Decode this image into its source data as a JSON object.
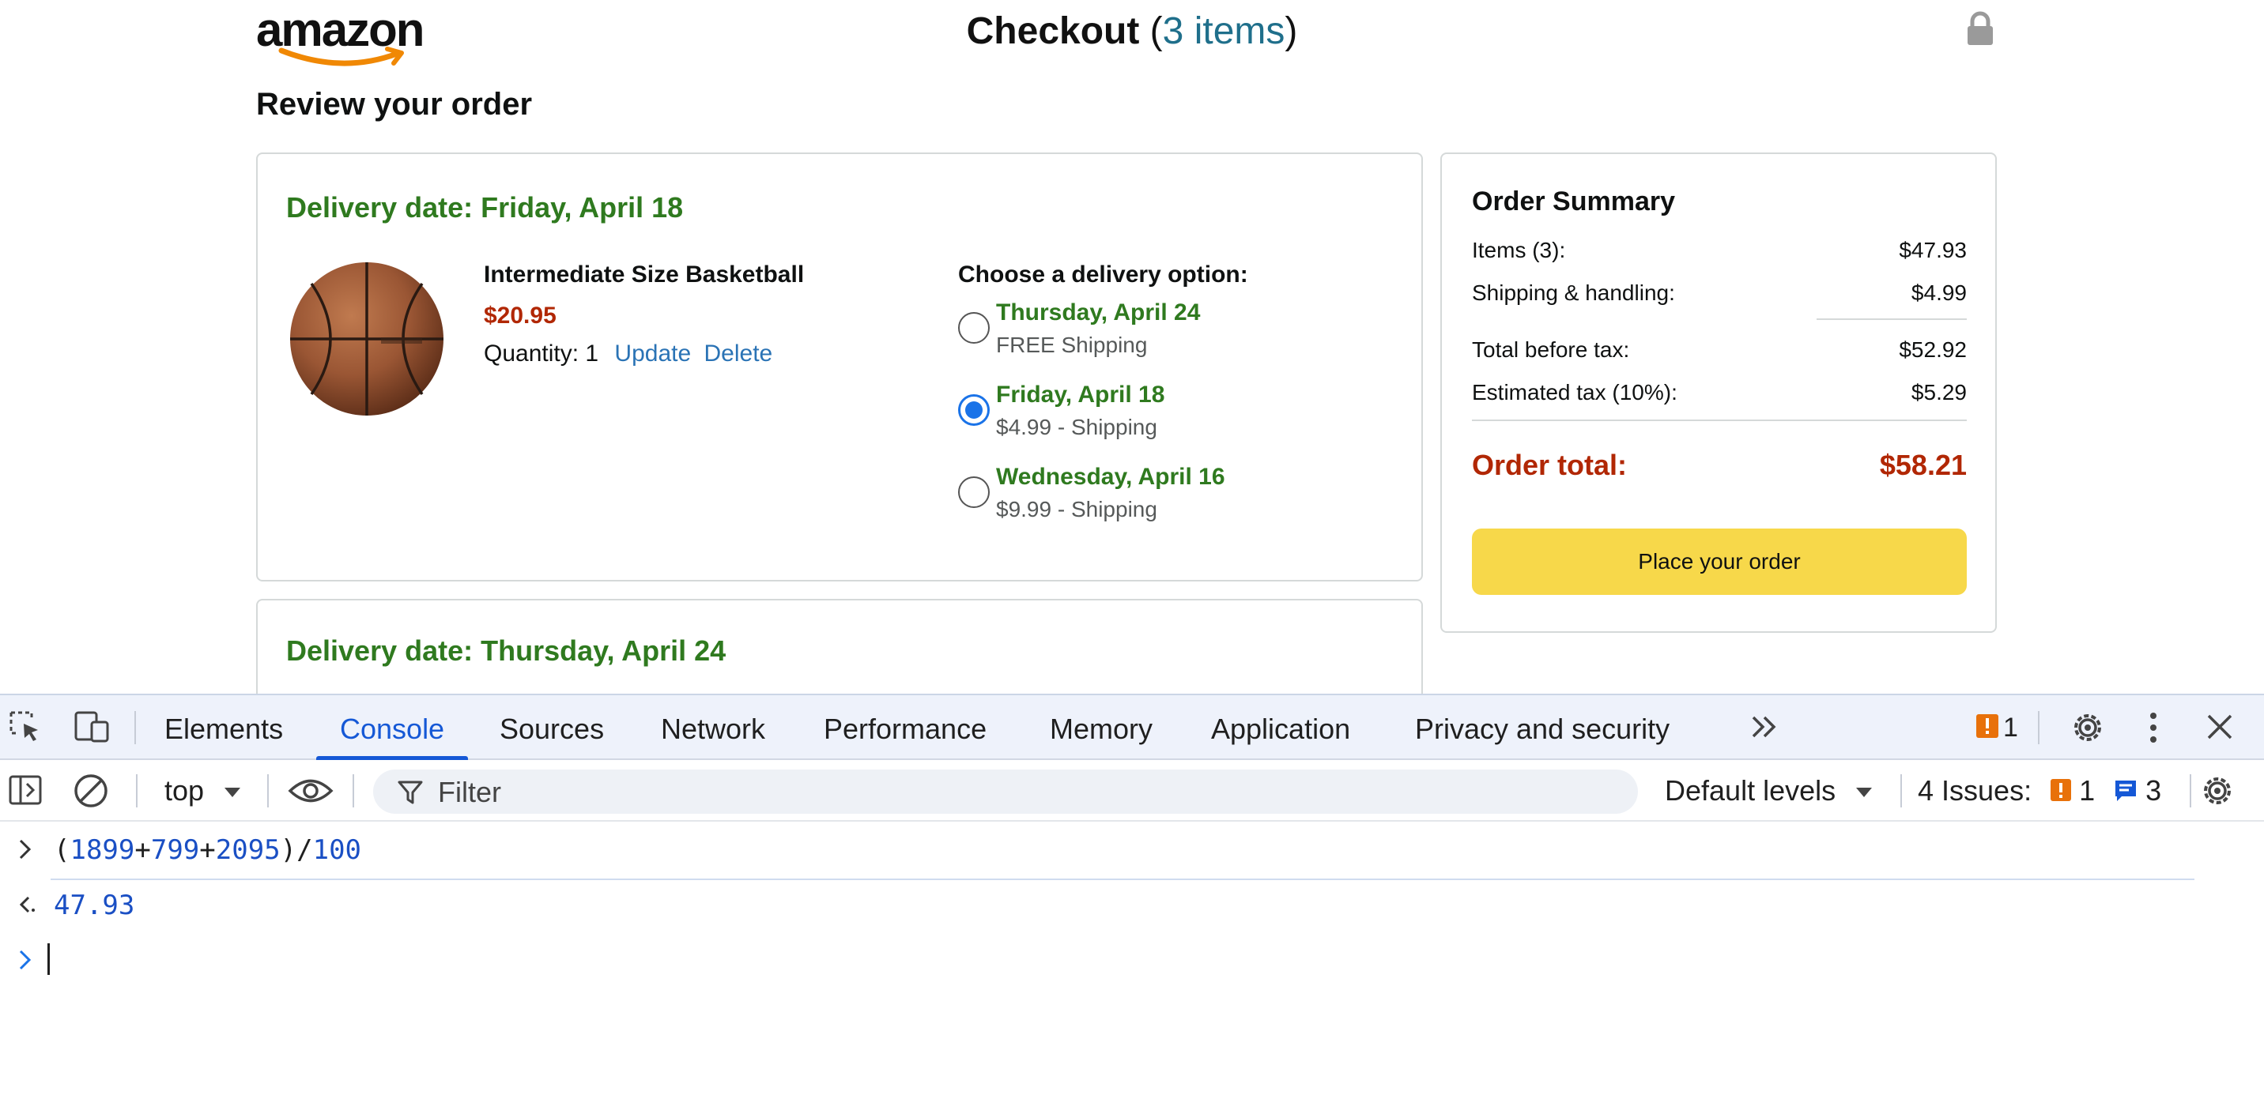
{
  "page": {
    "logo_text": "amazon",
    "checkout_title": {
      "prefix": "Checkout ",
      "open_paren": "(",
      "items_link": "3 items",
      "close_paren": ")"
    },
    "review_title": "Review your order",
    "shipments": [
      {
        "delivery_date": "Delivery date: Friday, April 18",
        "product": {
          "name": "Intermediate Size Basketball",
          "price": "$20.95",
          "quantity_label": "Quantity: 1",
          "update_label": "Update",
          "delete_label": "Delete"
        },
        "options_title": "Choose a delivery option:",
        "options": [
          {
            "date": "Thursday, April 24",
            "shipping": "FREE Shipping",
            "selected": false
          },
          {
            "date": "Friday, April 18",
            "shipping": "$4.99 - Shipping",
            "selected": true
          },
          {
            "date": "Wednesday, April 16",
            "shipping": "$9.99 - Shipping",
            "selected": false
          }
        ]
      },
      {
        "delivery_date": "Delivery date: Thursday, April 24"
      }
    ],
    "summary": {
      "title": "Order Summary",
      "items_label": "Items (3):",
      "items_value": "$47.93",
      "shipping_label": "Shipping & handling:",
      "shipping_value": "$4.99",
      "before_tax_label": "Total before tax:",
      "before_tax_value": "$52.92",
      "tax_label": "Estimated tax (10%):",
      "tax_value": "$5.29",
      "total_label": "Order total:",
      "total_value": "$58.21",
      "place_order_label": "Place your order"
    }
  },
  "devtools": {
    "tabs": [
      "Elements",
      "Console",
      "Sources",
      "Network",
      "Performance",
      "Memory",
      "Application",
      "Privacy and security"
    ],
    "active_tab": "Console",
    "error_count": "1",
    "toolbar": {
      "context": "top",
      "filter_placeholder": "Filter",
      "levels": "Default levels",
      "issues_label": "4 Issues:",
      "issues_errors": "1",
      "issues_info": "3"
    },
    "console": {
      "input_tokens": [
        "(",
        "1899",
        "+",
        "799",
        "+",
        "2095",
        ")/",
        "100"
      ],
      "output": "47.93"
    }
  },
  "colors": {
    "delivery_green": "#2f7a1f",
    "price_red": "#b12704",
    "link_blue": "#2a73b5",
    "button_yellow": "#f7d84a",
    "devtools_active": "#1558d6",
    "error_orange": "#e8710a"
  }
}
